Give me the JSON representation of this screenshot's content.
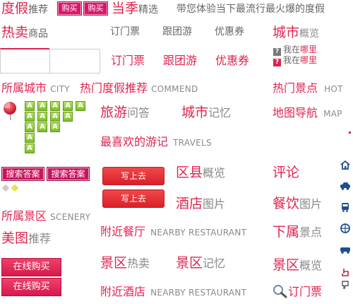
{
  "top_bar": {
    "dujia": "度假",
    "tuijian": "推荐",
    "buy1": "购买",
    "buy2": "购买",
    "dangji": "当季",
    "jingxuan": "精选",
    "slogan": "带您体验当下最流行最火爆的度假"
  },
  "row2": {
    "remai": "热卖",
    "shangpin": "商品",
    "tab1": "订门票",
    "tab2": "跟团游",
    "tab3": "优惠券",
    "city": "城市",
    "overview": "概览"
  },
  "row3": {
    "tab1": "订门票",
    "tab2": "跟团游",
    "tab3": "优惠券",
    "help1_pre": "我在",
    "help1_hl": "哪里",
    "help2_pre": "我在",
    "help2_hl": "哪里",
    "q_icon": "question-icon"
  },
  "row4": {
    "city_label": "所属城市",
    "city_en": "CITY",
    "hot_label": "热门度假推荐",
    "hot_en": "COMMEND",
    "spot_label": "热门景点",
    "spot_en": "HOT"
  },
  "letters": [
    "A",
    "A",
    "A",
    "A",
    "A",
    "A",
    "A",
    "A",
    "A",
    "A",
    "A",
    "A",
    "A",
    "A"
  ],
  "row5": {
    "travel": "旅游",
    "wenda": "问答",
    "city": "城市",
    "memory": "记忆",
    "map": "地图导航",
    "map_en": "MAP"
  },
  "row6": {
    "fav": "最喜欢的游记",
    "fav_en": "TRAVELS"
  },
  "search_buttons": [
    "搜索答案",
    "搜索答案"
  ],
  "write_buttons": [
    "写上去",
    "写上去"
  ],
  "row7": {
    "district": "区县",
    "district_overview": "概览",
    "comment": "评论",
    "hotel": "酒店",
    "pictures": "图片",
    "food": "餐饮",
    "food_pictures": "图片"
  },
  "row8": {
    "scenery_label": "所属景区",
    "scenery_en": "SCENERY",
    "meitu": "美图",
    "tuijian": "推荐",
    "restaurant": "附近餐厅",
    "restaurant_en": "NEARBY RESTAURANT",
    "xiashu": "下属",
    "jingdian": "景点"
  },
  "buy_buttons": [
    "在线购买",
    "在线购买"
  ],
  "row9": {
    "jingqu1": "景区",
    "hot": "热卖",
    "jingqu2": "景区",
    "memory": "记忆",
    "jingqu3": "景区",
    "overview": "概览"
  },
  "row10": {
    "hotel": "附近酒店",
    "hotel_en": "NEARBY RESTAURANT",
    "ticket": "订门票"
  },
  "colors": {
    "accent": "#e0234f",
    "pink_button": "#d9176a",
    "red_button": "#e0303a",
    "letter_green": "#8cc63f"
  }
}
